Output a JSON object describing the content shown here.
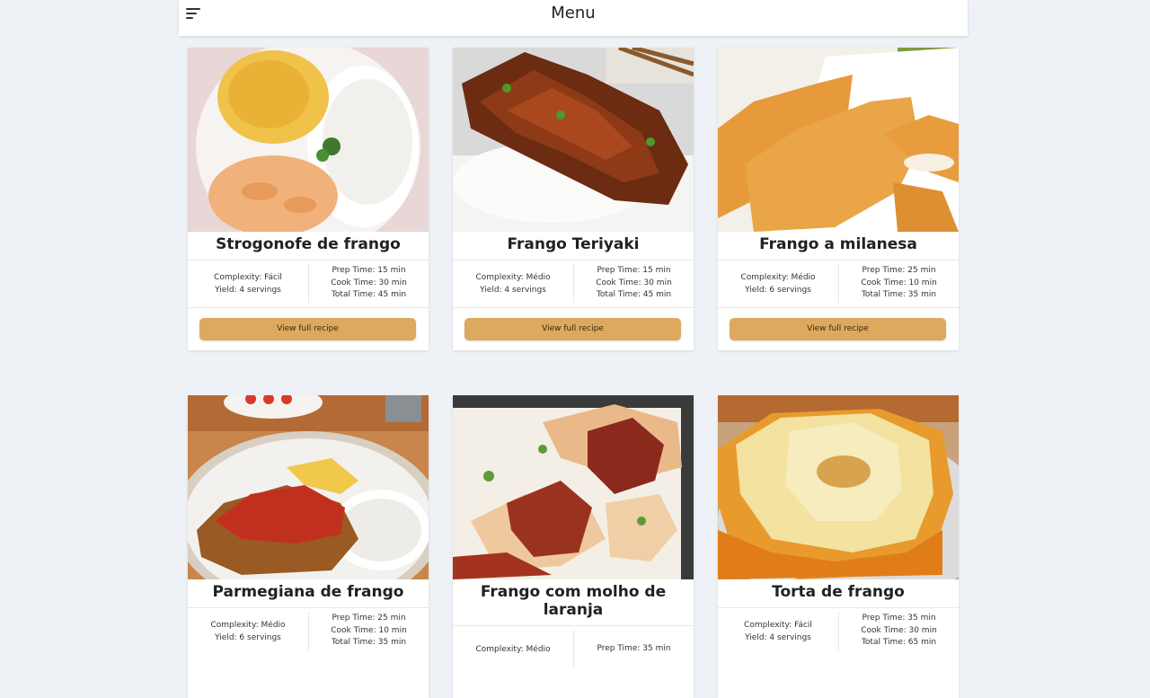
{
  "header": {
    "title": "Menu",
    "menu_icon": "hamburger-menu-icon"
  },
  "accent_color": "#dca95e",
  "recipes": [
    {
      "title": "Strogonofe de frango",
      "complexity": "Complexity: Fácil",
      "yield": "Yield: 4 servings",
      "prep": "Prep Time: 15 min",
      "cook": "Cook Time: 30 min",
      "total": "Total Time: 45 min",
      "button": "View full recipe"
    },
    {
      "title": "Frango Teriyaki",
      "complexity": "Complexity: Médio",
      "yield": "Yield: 4 servings",
      "prep": "Prep Time: 15 min",
      "cook": "Cook Time: 30 min",
      "total": "Total Time: 45 min",
      "button": "View full recipe"
    },
    {
      "title": "Frango a milanesa",
      "complexity": "Complexity: Médio",
      "yield": "Yield: 6 servings",
      "prep": "Prep Time: 25 min",
      "cook": "Cook Time: 10 min",
      "total": "Total Time: 35 min",
      "button": "View full recipe"
    },
    {
      "title": "Parmegiana de frango",
      "complexity": "Complexity: Médio",
      "yield": "Yield: 6 servings",
      "prep": "Prep Time: 25 min",
      "cook": "Cook Time: 10 min",
      "total": "Total Time: 35 min"
    },
    {
      "title": "Frango com molho de laranja",
      "complexity": "Complexity: Médio",
      "prep": "Prep Time: 35 min"
    },
    {
      "title": "Torta de frango",
      "complexity": "Complexity: Fácil",
      "yield": "Yield: 4 servings",
      "prep": "Prep Time: 35 min",
      "cook": "Cook Time: 30 min",
      "total": "Total Time: 65 min"
    }
  ]
}
